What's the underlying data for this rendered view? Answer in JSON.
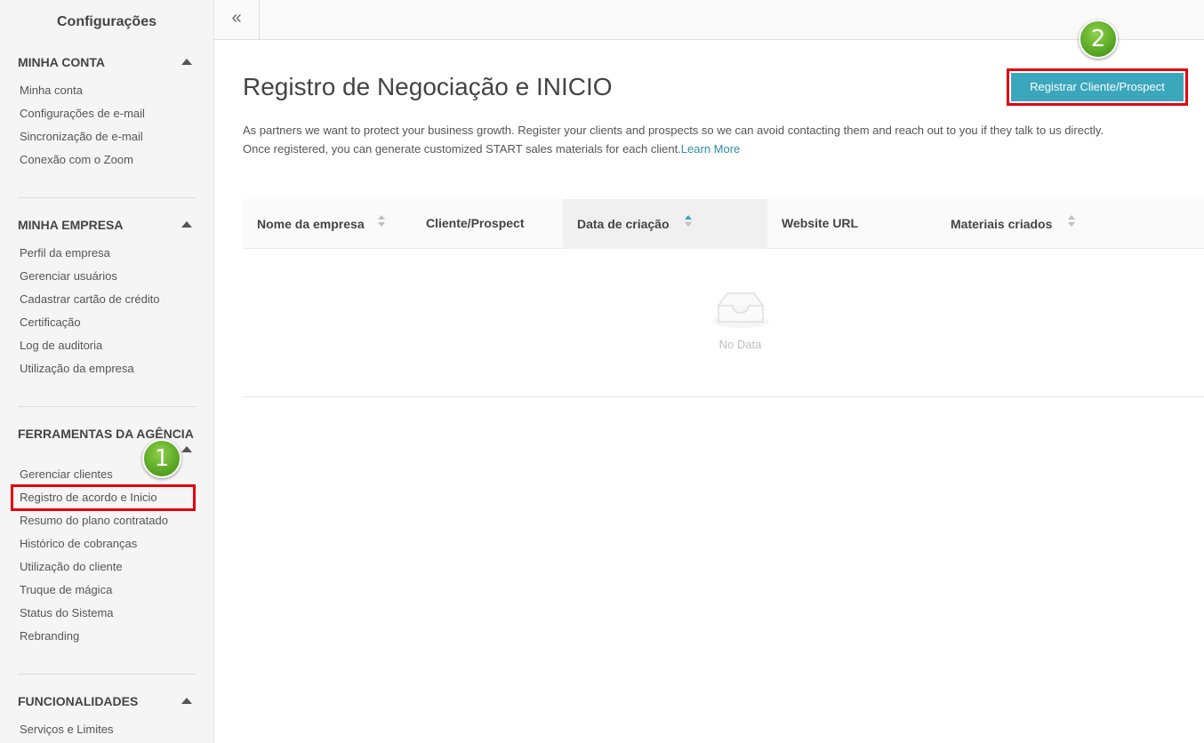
{
  "sidebar": {
    "title": "Configurações",
    "sections": [
      {
        "title": "MINHA CONTA",
        "items": [
          "Minha conta",
          "Configurações de e-mail",
          "Sincronização de e-mail",
          "Conexão com o Zoom"
        ]
      },
      {
        "title": "MINHA EMPRESA",
        "items": [
          "Perfil da empresa",
          "Gerenciar usuários",
          "Cadastrar cartão de crédito",
          "Certificação",
          "Log de auditoria",
          "Utilização da empresa"
        ]
      },
      {
        "title": "FERRAMENTAS DA AGÊNCIA",
        "items": [
          "Gerenciar clientes",
          "Registro de acordo e Inicio",
          "Resumo do plano contratado",
          "Histórico de cobranças",
          "Utilização do cliente",
          "Truque de mágica",
          "Status do Sistema",
          "Rebranding"
        ]
      },
      {
        "title": "FUNCIONALIDADES",
        "items": [
          "Serviços e Limites"
        ]
      }
    ]
  },
  "topbar": {
    "collapse_icon": "«"
  },
  "main": {
    "title": "Registro de Negociação e INICIO",
    "register_button": "Registrar Cliente/Prospect",
    "description_line1": "As partners we want to protect your business growth. Register your clients and prospects so we can avoid contacting them and reach out to you if they talk to us directly.",
    "description_line2": "Once registered, you can generate customized START sales materials for each client.",
    "learn_more": "Learn More",
    "table": {
      "columns": [
        "Nome da empresa",
        "Cliente/Prospect",
        "Data de criação",
        "Website URL",
        "Materiais criados"
      ],
      "empty_text": "No Data"
    }
  },
  "annotations": {
    "badge_1": "1",
    "badge_2": "2"
  },
  "colors": {
    "accent": "#3aa7bd",
    "highlight": "#e3000f",
    "badge": "#5aa826"
  }
}
